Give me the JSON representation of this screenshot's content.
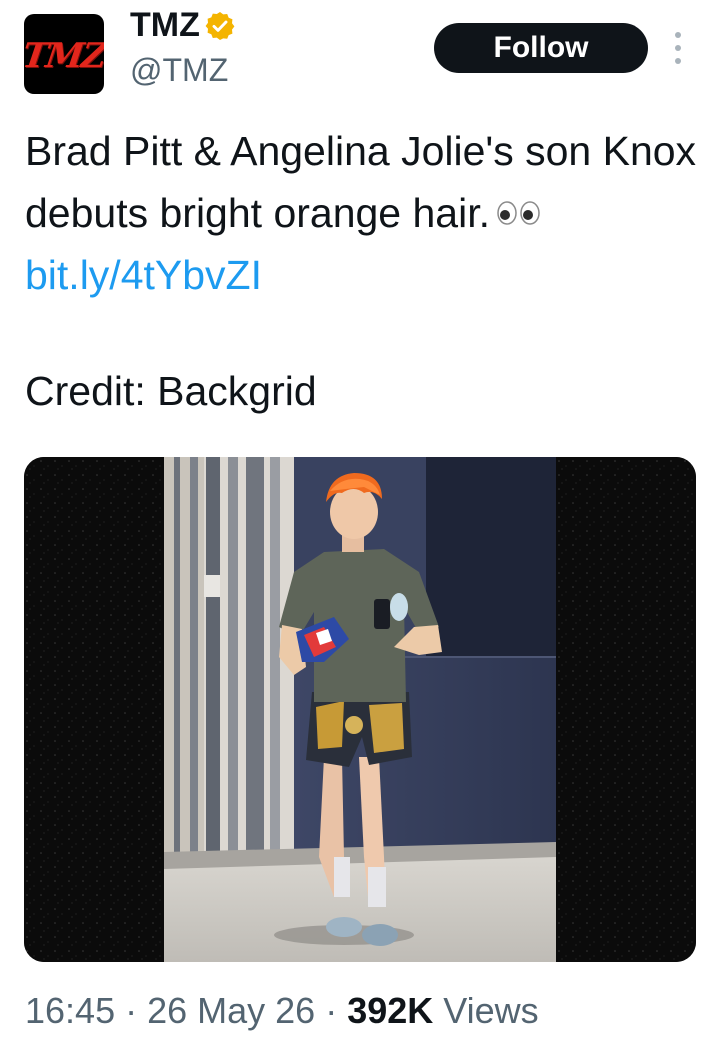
{
  "account": {
    "display_name": "TMZ",
    "handle": "@TMZ",
    "avatar_logo_text": "TMZ",
    "verified_badge_icon": "verified-gold-badge-icon",
    "verified_color": "#f4b400"
  },
  "actions": {
    "follow_label": "Follow",
    "more_icon": "more-vertical-icon"
  },
  "tweet": {
    "text_main": "Brad Pitt & Angelina Jolie's son Knox debuts bright orange hair.",
    "emoji_icon": "eyes-emoji-icon",
    "link_text": "bit.ly/4tYbvZI",
    "credit": "Credit: Backgrid",
    "link_color": "#1d9bf0"
  },
  "media": {
    "image_icon": "photo-young-man-orange-hair-walking"
  },
  "meta": {
    "time": "16:45",
    "separator": " · ",
    "date": "26 May 26",
    "views_count": "392K",
    "views_label": "Views"
  }
}
